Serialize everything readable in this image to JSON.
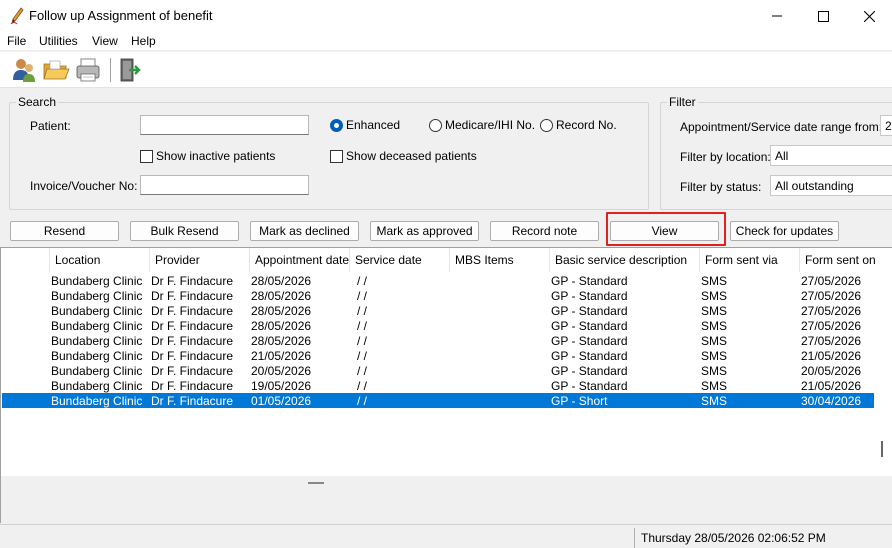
{
  "window": {
    "title": "Follow up Assignment of benefit",
    "controls": [
      "minimize-icon",
      "maximize-icon",
      "close-icon"
    ]
  },
  "menu": [
    "File",
    "Utilities",
    "View",
    "Help"
  ],
  "toolbar": {
    "icons": [
      "patients-icon",
      "open-folder-icon",
      "printer-icon",
      "exit-door-icon"
    ]
  },
  "search": {
    "title": "Search",
    "patient_label": "Patient:",
    "patient_value": "",
    "invoice_label": "Invoice/Voucher No:",
    "invoice_value": "",
    "show_inactive": "Show inactive patients",
    "show_deceased": "Show deceased patients",
    "radios": [
      {
        "label": "Enhanced",
        "checked": true
      },
      {
        "label": "Medicare/IHI No.",
        "checked": false
      },
      {
        "label": "Record No.",
        "checked": false
      }
    ]
  },
  "filter": {
    "title": "Filter",
    "date_range_label": "Appointment/Service date range from:",
    "date_range_value": "2",
    "location_label": "Filter by location:",
    "location_value": "All",
    "status_label": "Filter by status:",
    "status_value": "All outstanding"
  },
  "actions": {
    "resend": "Resend",
    "bulk_resend": "Bulk Resend",
    "mark_declined": "Mark as declined",
    "mark_approved": "Mark as approved",
    "record_note": "Record note",
    "view": "View",
    "check_updates": "Check for updates"
  },
  "table": {
    "columns": [
      "Location",
      "Provider",
      "Appointment date",
      "Service date",
      "MBS Items",
      "Basic service description",
      "Form sent via",
      "Form sent on"
    ],
    "rows": [
      {
        "location": "Bundaberg Clinic",
        "provider": "Dr F. Findacure",
        "appointment_date": "28/05/2026",
        "service_date": " /  /",
        "mbs_items": "",
        "description": "GP - Standard",
        "sent_via": "SMS",
        "sent_on": "27/05/2026",
        "selected": false
      },
      {
        "location": "Bundaberg Clinic",
        "provider": "Dr F. Findacure",
        "appointment_date": "28/05/2026",
        "service_date": " /  /",
        "mbs_items": "",
        "description": "GP - Standard",
        "sent_via": "SMS",
        "sent_on": "27/05/2026",
        "selected": false
      },
      {
        "location": "Bundaberg Clinic",
        "provider": "Dr F. Findacure",
        "appointment_date": "28/05/2026",
        "service_date": " /  /",
        "mbs_items": "",
        "description": "GP - Standard",
        "sent_via": "SMS",
        "sent_on": "27/05/2026",
        "selected": false
      },
      {
        "location": "Bundaberg Clinic",
        "provider": "Dr F. Findacure",
        "appointment_date": "28/05/2026",
        "service_date": " /  /",
        "mbs_items": "",
        "description": "GP - Standard",
        "sent_via": "SMS",
        "sent_on": "27/05/2026",
        "selected": false
      },
      {
        "location": "Bundaberg Clinic",
        "provider": "Dr F. Findacure",
        "appointment_date": "28/05/2026",
        "service_date": " /  /",
        "mbs_items": "",
        "description": "GP - Standard",
        "sent_via": "SMS",
        "sent_on": "27/05/2026",
        "selected": false
      },
      {
        "location": "Bundaberg Clinic",
        "provider": "Dr F. Findacure",
        "appointment_date": "21/05/2026",
        "service_date": " /  /",
        "mbs_items": "",
        "description": "GP - Standard",
        "sent_via": "SMS",
        "sent_on": "21/05/2026",
        "selected": false
      },
      {
        "location": "Bundaberg Clinic",
        "provider": "Dr F. Findacure",
        "appointment_date": "20/05/2026",
        "service_date": " /  /",
        "mbs_items": "",
        "description": "GP - Standard",
        "sent_via": "SMS",
        "sent_on": "20/05/2026",
        "selected": false
      },
      {
        "location": "Bundaberg Clinic",
        "provider": "Dr F. Findacure",
        "appointment_date": "19/05/2026",
        "service_date": " /  /",
        "mbs_items": "",
        "description": "GP - Standard",
        "sent_via": "SMS",
        "sent_on": "21/05/2026",
        "selected": false
      },
      {
        "location": "Bundaberg Clinic",
        "provider": "Dr F. Findacure",
        "appointment_date": "01/05/2026",
        "service_date": " /  /",
        "mbs_items": "",
        "description": "GP - Short",
        "sent_via": "SMS",
        "sent_on": "30/04/2026",
        "selected": true
      }
    ]
  },
  "status": {
    "datetime": "Thursday 28/05/2026 02:06:52 PM"
  },
  "colors": {
    "selection": "#0078d7",
    "highlight_box": "#dd2222",
    "radio_accent": "#005fb8"
  }
}
